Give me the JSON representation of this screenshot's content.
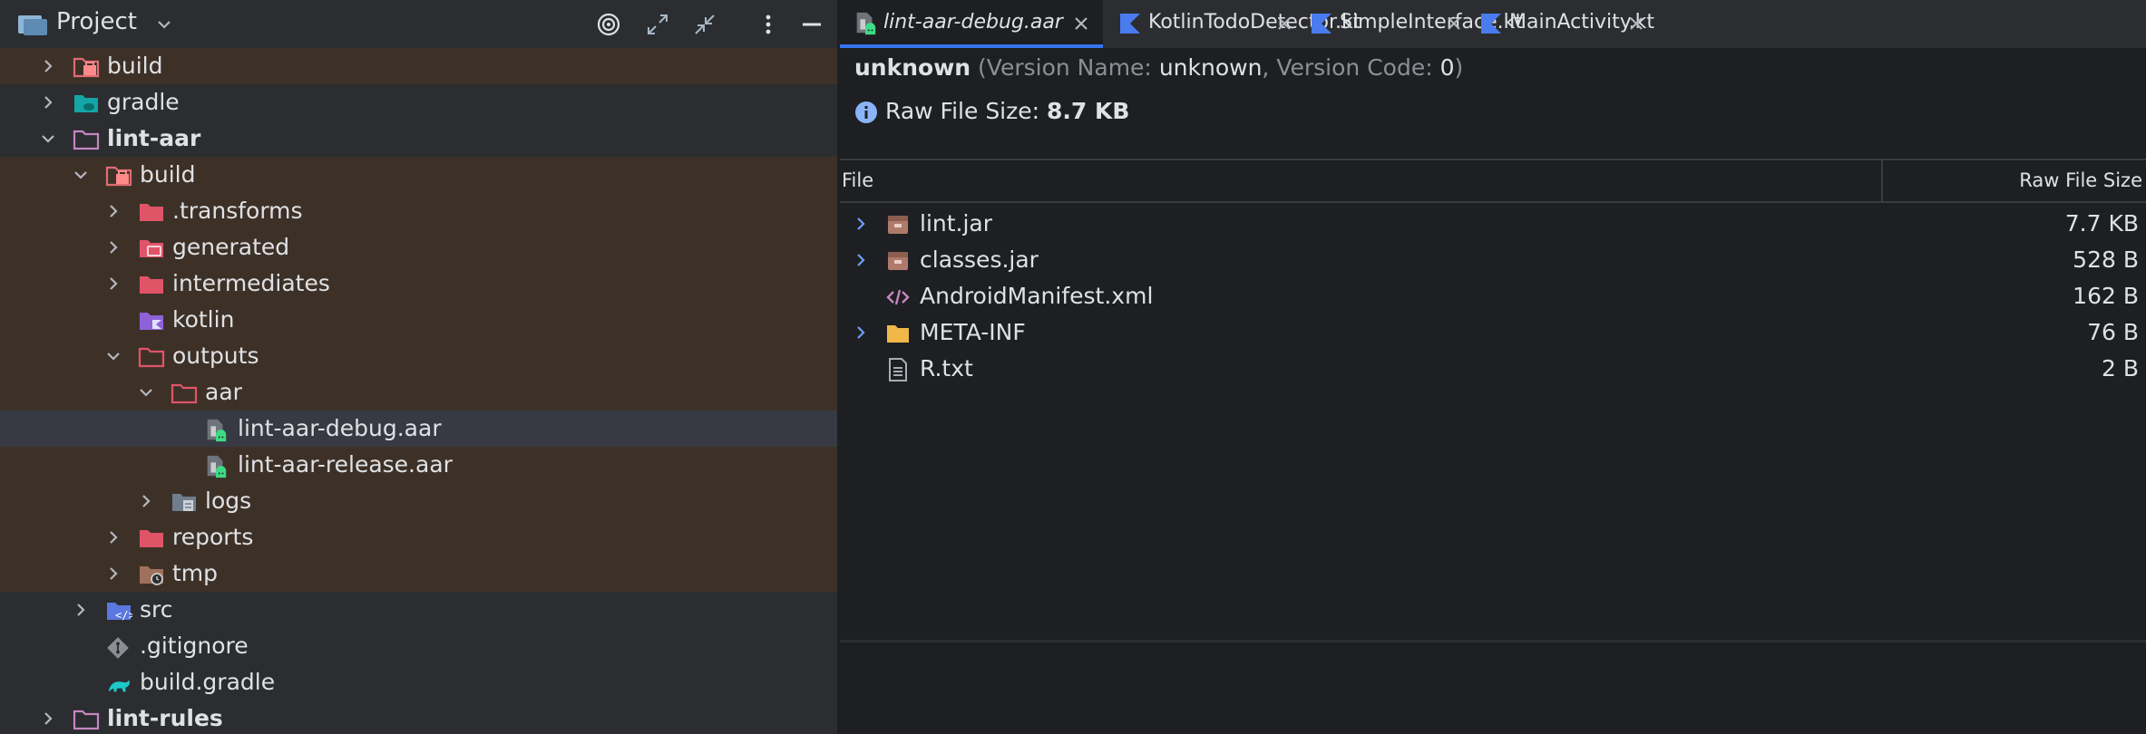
{
  "project": {
    "title": "Project",
    "tree": [
      {
        "label": "build",
        "arrow": "right",
        "icon": "build-folder-icon",
        "indent": 0,
        "excluded": true,
        "bold": false
      },
      {
        "label": "gradle",
        "arrow": "right",
        "icon": "gradle-folder-icon",
        "indent": 0,
        "excluded": false,
        "bold": false
      },
      {
        "label": "lint-aar",
        "arrow": "down",
        "icon": "module-folder-icon",
        "indent": 0,
        "excluded": false,
        "bold": true
      },
      {
        "label": "build",
        "arrow": "down",
        "icon": "build-folder-icon",
        "indent": 1,
        "excluded": true,
        "bold": false
      },
      {
        "label": ".transforms",
        "arrow": "right",
        "icon": "excluded-folder-icon",
        "indent": 2,
        "excluded": true,
        "bold": false
      },
      {
        "label": "generated",
        "arrow": "right",
        "icon": "generated-folder-icon",
        "indent": 2,
        "excluded": true,
        "bold": false
      },
      {
        "label": "intermediates",
        "arrow": "right",
        "icon": "excluded-folder-icon",
        "indent": 2,
        "excluded": true,
        "bold": false
      },
      {
        "label": "kotlin",
        "arrow": "none",
        "icon": "kotlin-folder-icon",
        "indent": 2,
        "excluded": true,
        "bold": false
      },
      {
        "label": "outputs",
        "arrow": "down",
        "icon": "outline-folder-icon",
        "indent": 2,
        "excluded": true,
        "bold": false
      },
      {
        "label": "aar",
        "arrow": "down",
        "icon": "outline-folder-icon",
        "indent": 3,
        "excluded": true,
        "bold": false
      },
      {
        "label": "lint-aar-debug.aar",
        "arrow": "none",
        "icon": "aar-file-icon",
        "indent": 4,
        "excluded": false,
        "bold": false,
        "selected": true
      },
      {
        "label": "lint-aar-release.aar",
        "arrow": "none",
        "icon": "aar-file-icon",
        "indent": 4,
        "excluded": true,
        "bold": false
      },
      {
        "label": "logs",
        "arrow": "right",
        "icon": "logs-folder-icon",
        "indent": 3,
        "excluded": true,
        "bold": false
      },
      {
        "label": "reports",
        "arrow": "right",
        "icon": "excluded-folder-icon",
        "indent": 2,
        "excluded": true,
        "bold": false
      },
      {
        "label": "tmp",
        "arrow": "right",
        "icon": "tmp-folder-icon",
        "indent": 2,
        "excluded": true,
        "bold": false
      },
      {
        "label": "src",
        "arrow": "right",
        "icon": "src-folder-icon",
        "indent": 1,
        "excluded": false,
        "bold": false
      },
      {
        "label": ".gitignore",
        "arrow": "none",
        "icon": "gitignore-icon",
        "indent": 1,
        "excluded": false,
        "bold": false
      },
      {
        "label": "build.gradle",
        "arrow": "none",
        "icon": "gradle-file-icon",
        "indent": 1,
        "excluded": false,
        "bold": false
      },
      {
        "label": "lint-rules",
        "arrow": "right",
        "icon": "module-folder-icon",
        "indent": 0,
        "excluded": false,
        "bold": true
      }
    ]
  },
  "tabs": [
    {
      "label": "lint-aar-debug.aar",
      "icon": "aar-file-icon",
      "active": true
    },
    {
      "label": "KotlinTodoDetector.kt",
      "icon": "kotlin-file-icon",
      "active": false
    },
    {
      "label": "SimpleInterface.kt",
      "icon": "kotlin-file-icon",
      "active": false
    },
    {
      "label": "MainActivity.kt",
      "icon": "kotlin-file-icon",
      "active": false
    }
  ],
  "info": {
    "app_id": "unknown",
    "version_name_label": "(Version Name: ",
    "version_name": "unknown",
    "version_code_label": ", Version Code: ",
    "version_code": "0",
    "close_paren": ")",
    "raw_size_label": "Raw File Size: ",
    "raw_size": "8.7 KB"
  },
  "table": {
    "col_file": "File",
    "col_size": "Raw File Size",
    "rows": [
      {
        "name": "lint.jar",
        "size": "7.7 KB",
        "arrow": true,
        "icon": "jar-icon"
      },
      {
        "name": "classes.jar",
        "size": "528 B",
        "arrow": true,
        "icon": "jar-icon"
      },
      {
        "name": "AndroidManifest.xml",
        "size": "162 B",
        "arrow": false,
        "icon": "xml-icon"
      },
      {
        "name": "META-INF",
        "size": "76 B",
        "arrow": true,
        "icon": "folder-icon"
      },
      {
        "name": "R.txt",
        "size": "2 B",
        "arrow": false,
        "icon": "text-file-icon"
      }
    ]
  },
  "colors": {
    "panel": "#2b2d30",
    "editor": "#1e1f22",
    "excluded_row": "#3d3127",
    "selected_row": "#373a43",
    "accent": "#3574f0"
  }
}
